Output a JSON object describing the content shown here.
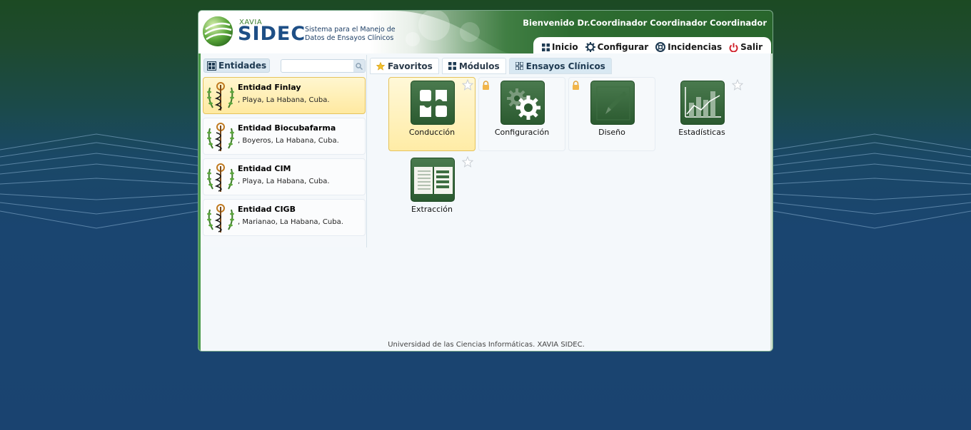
{
  "header": {
    "logo_top": "XAVIA",
    "logo_main": "SIDEC",
    "logo_sub_line1": "Sistema para el Manejo de",
    "logo_sub_line2": "Datos de Ensayos Clínicos",
    "welcome": "Bienvenido Dr.Coordinador Coordinador Coordinador"
  },
  "topnav": [
    {
      "label": "Inicio",
      "icon": "grid-icon"
    },
    {
      "label": "Configurar",
      "icon": "gear-icon"
    },
    {
      "label": "Incidencias",
      "icon": "lifebuoy-icon"
    },
    {
      "label": "Salir",
      "icon": "power-icon"
    }
  ],
  "left": {
    "tab_label": "Entidades",
    "search_placeholder": "",
    "entities": [
      {
        "name": "Entidad Finlay",
        "address": ", Playa, La Habana, Cuba.",
        "active": true
      },
      {
        "name": "Entidad Biocubafarma",
        "address": ", Boyeros, La Habana, Cuba.",
        "active": false
      },
      {
        "name": "Entidad CIM",
        "address": ", Playa, La Habana, Cuba.",
        "active": false
      },
      {
        "name": "Entidad CIGB",
        "address": ", Marianao, La Habana, Cuba.",
        "active": false
      }
    ]
  },
  "tabs": [
    {
      "label": "Favoritos",
      "icon": "star-icon"
    },
    {
      "label": "Módulos",
      "icon": "grid-icon"
    },
    {
      "label": "Ensayos Clínicos",
      "icon": "grid-icon"
    }
  ],
  "modules": [
    {
      "label": "Conducción",
      "icon": "puzzle-icon",
      "locked": false
    },
    {
      "label": "Configuración",
      "icon": "gears-icon",
      "locked": true
    },
    {
      "label": "Diseño",
      "icon": "pencil-icon",
      "locked": true
    },
    {
      "label": "Estadísticas",
      "icon": "bar-chart-icon",
      "locked": false
    },
    {
      "label": "Extracción",
      "icon": "book-icon",
      "locked": false
    }
  ],
  "footer": "Universidad de las Ciencias Informáticas. XAVIA SIDEC.",
  "colors": {
    "accent_green": "#2f6e33",
    "brand_blue": "#1e4f86",
    "active_yellow": "#ffe9a0"
  }
}
